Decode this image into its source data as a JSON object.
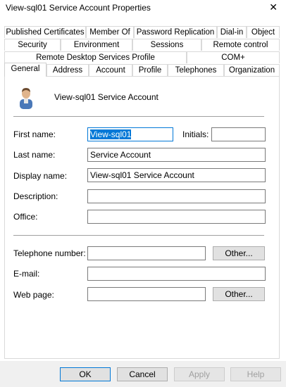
{
  "window": {
    "title": "View-sql01 Service Account Properties",
    "close_glyph": "✕"
  },
  "tabs": {
    "row1": [
      "Published Certificates",
      "Member Of",
      "Password Replication",
      "Dial-in",
      "Object"
    ],
    "row2": [
      "Security",
      "Environment",
      "Sessions",
      "Remote control"
    ],
    "row3": [
      "Remote Desktop Services Profile",
      "COM+"
    ],
    "row4": [
      "General",
      "Address",
      "Account",
      "Profile",
      "Telephones",
      "Organization"
    ],
    "selected": "General"
  },
  "general": {
    "account_name": "View-sql01 Service Account",
    "avatar_icon": "user-icon",
    "first_name_label": "First name:",
    "first_name_value": "View-sql01",
    "initials_label": "Initials:",
    "initials_value": "",
    "last_name_label": "Last name:",
    "last_name_value": "Service Account",
    "display_name_label": "Display name:",
    "display_name_value": "View-sql01 Service Account",
    "description_label": "Description:",
    "description_value": "",
    "office_label": "Office:",
    "office_value": "",
    "telephone_label": "Telephone number:",
    "telephone_value": "",
    "email_label": "E-mail:",
    "email_value": "",
    "webpage_label": "Web page:",
    "webpage_value": "",
    "other_label": "Other..."
  },
  "buttons": {
    "ok": "OK",
    "cancel": "Cancel",
    "apply": "Apply",
    "help": "Help"
  },
  "colors": {
    "selection": "#0078d7",
    "button_bg": "#e1e1e1",
    "disabled_text": "#a0a0a0"
  }
}
